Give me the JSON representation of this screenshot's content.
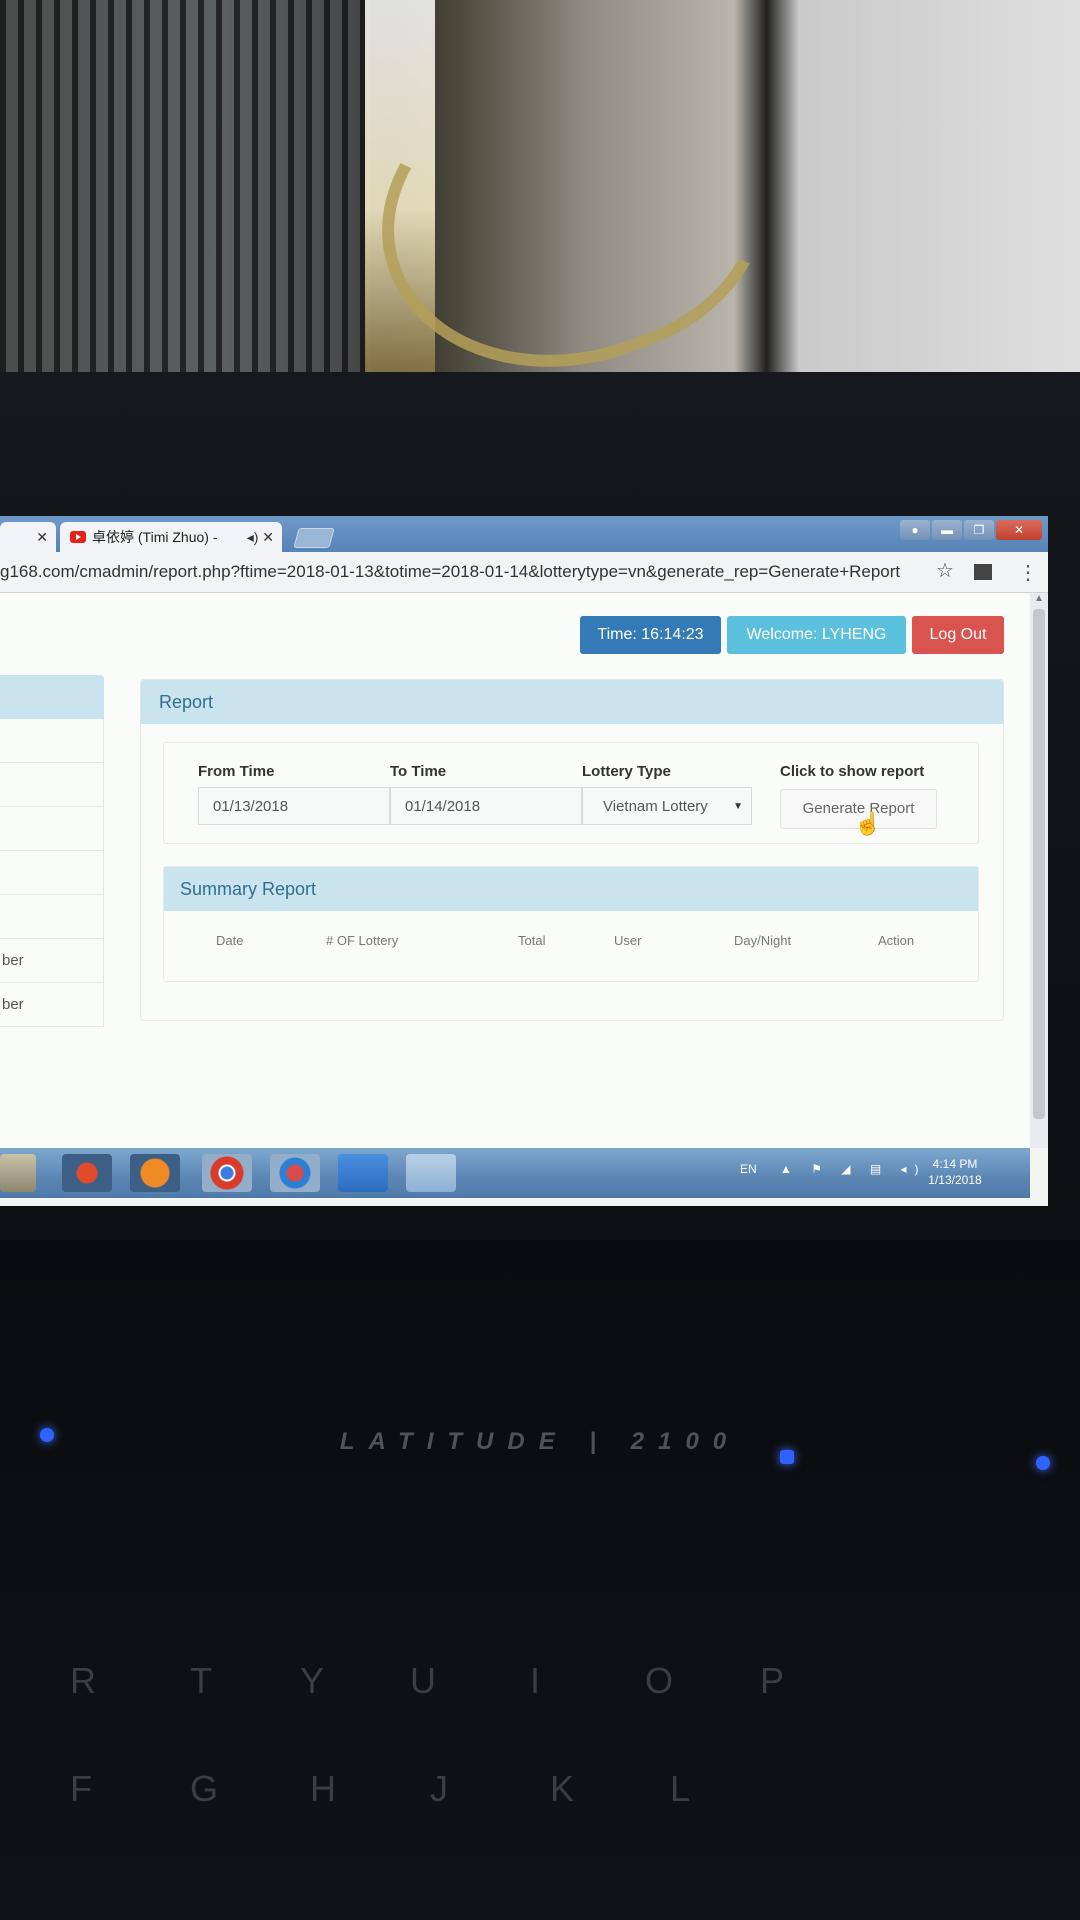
{
  "browser": {
    "tabs": [
      {
        "label": ""
      },
      {
        "label": "卓依婷 (Timi Zhuo) - "
      }
    ],
    "url": "g168.com/cmadmin/report.php?ftime=2018-01-13&totime=2018-01-14&lotterytype=vn&generate_rep=Generate+Report"
  },
  "header": {
    "time_label": "Time: 16:14:23",
    "welcome_label": "Welcome: LYHENG",
    "logout_label": "Log Out"
  },
  "sidebar": {
    "items": [
      "",
      "",
      "",
      "",
      "",
      "ber",
      "ber"
    ]
  },
  "report": {
    "title": "Report",
    "from_label": "From Time",
    "from_value": "01/13/2018",
    "to_label": "To Time",
    "to_value": "01/14/2018",
    "type_label": "Lottery Type",
    "type_value": "Vietnam Lottery",
    "show_label": "Click to show report",
    "generate_label": "Generate Report"
  },
  "summary": {
    "title": "Summary Report",
    "columns": [
      "Date",
      "# OF Lottery",
      "Total",
      "User",
      "Day/Night",
      "Action"
    ]
  },
  "taskbar": {
    "language": "EN",
    "time": "4:14 PM",
    "date": "1/13/2018"
  },
  "laptop": {
    "brand": "LATITUDE",
    "model": "2100"
  },
  "colors": {
    "time_button": "#337ab7",
    "welcome_button": "#5bc0de",
    "logout_button": "#d9534f",
    "panel_heading": "#c9e4ee"
  }
}
